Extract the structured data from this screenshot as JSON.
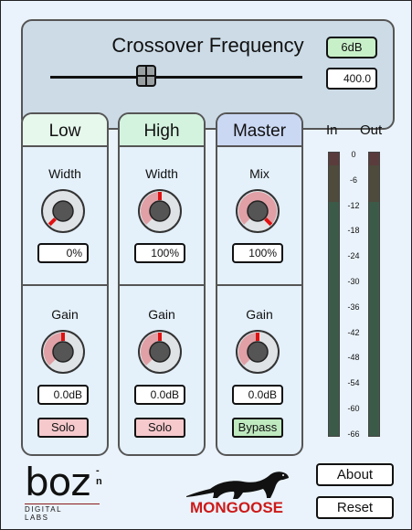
{
  "crossover": {
    "title": "Crossover Frequency",
    "db_toggle": "6dB",
    "frequency_value": "400.0",
    "slider_position": 0.38
  },
  "strips": [
    {
      "name": "Low",
      "header_color": "#e6f7ec",
      "top_label": "Width",
      "top_value": "0%",
      "top_level": 0.0,
      "gain_label": "Gain",
      "gain_value": "0.0dB",
      "gain_level": 0.5,
      "button": "Solo",
      "button_color": "#f6c9cc"
    },
    {
      "name": "High",
      "header_color": "#d4f3df",
      "top_label": "Width",
      "top_value": "100%",
      "top_level": 0.5,
      "gain_label": "Gain",
      "gain_value": "0.0dB",
      "gain_level": 0.5,
      "button": "Solo",
      "button_color": "#f6c9cc"
    },
    {
      "name": "Master",
      "header_color": "#cbd8f4",
      "top_label": "Mix",
      "top_value": "100%",
      "top_level": 1.0,
      "gain_label": "Gain",
      "gain_value": "0.0dB",
      "gain_level": 0.5,
      "button": "Bypass",
      "button_color": "#bfe9bf"
    }
  ],
  "meters": {
    "in_label": "In",
    "out_label": "Out",
    "ticks": [
      "0",
      "-6",
      "-12",
      "-18",
      "-24",
      "-30",
      "-36",
      "-42",
      "-48",
      "-54",
      "-60",
      "-66"
    ]
  },
  "brand": {
    "boz": "boz",
    "boz_sup": "-n",
    "boz_sub": "DIGITAL LABS",
    "product": "MONGOOSE"
  },
  "buttons": {
    "about": "About",
    "reset": "Reset"
  },
  "colors": {
    "accent_red": "#cc1a1a",
    "knob_fill": "#e0a0a6",
    "meter_green": "#3c5a48"
  }
}
